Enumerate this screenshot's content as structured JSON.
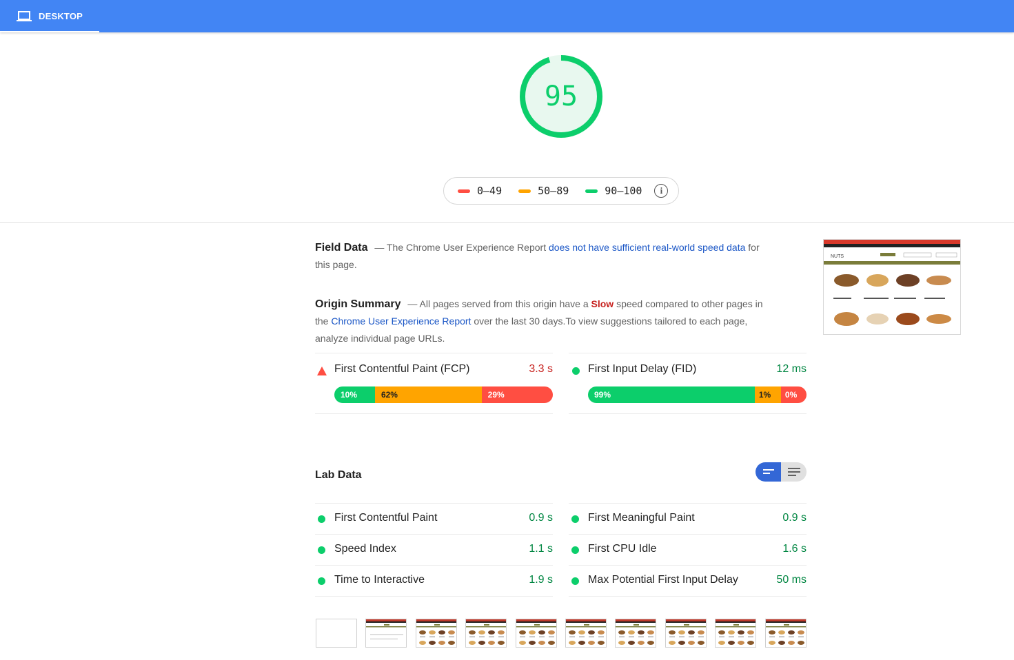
{
  "tab": {
    "label": "DESKTOP"
  },
  "score": {
    "value": "95",
    "fraction": 0.95,
    "color": "#0cce6b"
  },
  "legend": {
    "items": [
      {
        "label": "0–49",
        "color": "#ff4e42"
      },
      {
        "label": "50–89",
        "color": "#ffa400"
      },
      {
        "label": "90–100",
        "color": "#0cce6b"
      }
    ]
  },
  "field_data": {
    "title": "Field Data",
    "dash": "—",
    "text_before": "The Chrome User Experience Report ",
    "link": "does not have sufficient real-world speed data",
    "text_after": " for this page."
  },
  "origin_summary": {
    "title": "Origin Summary",
    "dash": "—",
    "text1": "All pages served from this origin have a ",
    "slow": "Slow",
    "text2": " speed compared to other pages in the ",
    "link": "Chrome User Experience Report",
    "text3": " over the last 30 days.To view suggestions tailored to each page, analyze individual page URLs."
  },
  "field_metrics": [
    {
      "name": "First Contentful Paint (FCP)",
      "value": "3.3 s",
      "value_color": "#c7221f",
      "status": "fail",
      "distribution": [
        {
          "label": "10%",
          "share": 10,
          "color": "#0cce6b",
          "text_color": "#ffffff"
        },
        {
          "label": "62%",
          "share": 62,
          "color": "#ffa400",
          "text_color": "#212121"
        },
        {
          "label": "29%",
          "share": 29,
          "color": "#ff4e42",
          "text_color": "#ffffff"
        }
      ]
    },
    {
      "name": "First Input Delay (FID)",
      "value": "12 ms",
      "value_color": "#018642",
      "status": "pass",
      "distribution": [
        {
          "label": "99%",
          "share": 99,
          "color": "#0cce6b",
          "text_color": "#ffffff"
        },
        {
          "label": "1%",
          "share": 1,
          "color": "#ffa400",
          "text_color": "#212121"
        },
        {
          "label": "0%",
          "share": 0,
          "color": "#ff4e42",
          "text_color": "#ffffff"
        }
      ]
    }
  ],
  "lab_data": {
    "title": "Lab Data",
    "left": [
      {
        "name": "First Contentful Paint",
        "value": "0.9 s"
      },
      {
        "name": "Speed Index",
        "value": "1.1 s"
      },
      {
        "name": "Time to Interactive",
        "value": "1.9 s"
      }
    ],
    "right": [
      {
        "name": "First Meaningful Paint",
        "value": "0.9 s"
      },
      {
        "name": "First CPU Idle",
        "value": "1.6 s"
      },
      {
        "name": "Max Potential First Input Delay",
        "value": "50 ms"
      }
    ]
  },
  "filmstrip": {
    "frame_count": 10
  }
}
